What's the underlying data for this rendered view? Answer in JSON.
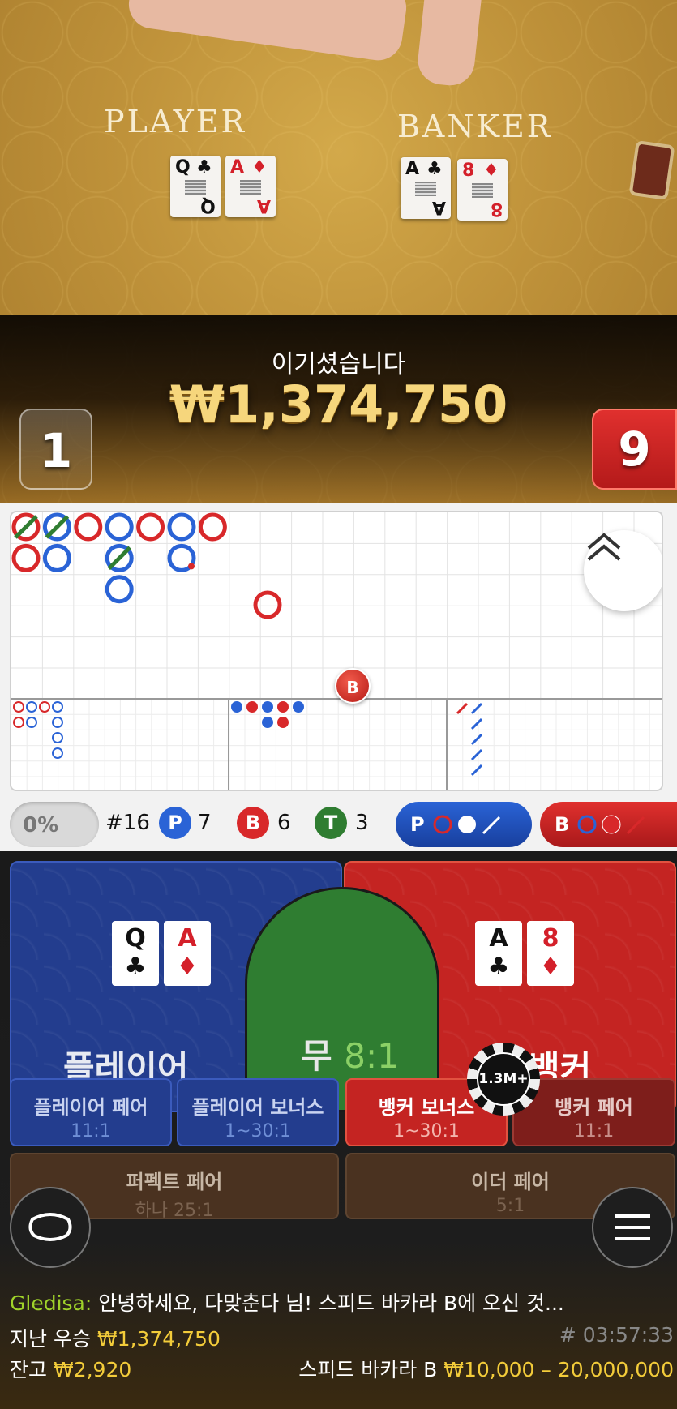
{
  "table_felt": {
    "player_word": "PLAYER",
    "banker_word": "BANKER"
  },
  "dealt_cards": {
    "player": [
      {
        "rank": "Q",
        "suit": "♣",
        "color": "black"
      },
      {
        "rank": "A",
        "suit": "♦",
        "color": "red"
      }
    ],
    "banker": [
      {
        "rank": "A",
        "suit": "♣",
        "color": "black"
      },
      {
        "rank": "8",
        "suit": "♦",
        "color": "red"
      }
    ]
  },
  "result": {
    "title": "이기셨습니다",
    "amount": "₩1,374,750",
    "player_score": "1",
    "banker_score": "9"
  },
  "roadmap": {
    "marker_label": "B",
    "big_road": [
      {
        "col": 0,
        "row": 0,
        "side": "banker",
        "tie": true
      },
      {
        "col": 0,
        "row": 1,
        "side": "banker"
      },
      {
        "col": 1,
        "row": 0,
        "side": "player",
        "tie": true
      },
      {
        "col": 1,
        "row": 1,
        "side": "player"
      },
      {
        "col": 2,
        "row": 0,
        "side": "banker"
      },
      {
        "col": 3,
        "row": 0,
        "side": "player"
      },
      {
        "col": 3,
        "row": 1,
        "side": "player",
        "tie": true
      },
      {
        "col": 3,
        "row": 2,
        "side": "player"
      },
      {
        "col": 4,
        "row": 0,
        "side": "banker"
      },
      {
        "col": 5,
        "row": 0,
        "side": "player"
      },
      {
        "col": 5,
        "row": 1,
        "side": "player",
        "pending": true
      },
      {
        "col": 6,
        "row": 0,
        "side": "banker"
      }
    ]
  },
  "stats": {
    "percent": "0%",
    "round": "#16",
    "player": {
      "letter": "P",
      "count": "7"
    },
    "banker": {
      "letter": "B",
      "count": "6"
    },
    "tie": {
      "letter": "T",
      "count": "3"
    },
    "ask_player": "P",
    "ask_banker": "B"
  },
  "bets": {
    "player": {
      "label": "플레이어"
    },
    "tie": {
      "label": "무",
      "odds": "8:1"
    },
    "banker": {
      "label": "뱅커"
    },
    "player_pair": {
      "label": "플레이어 페어",
      "odds": "11:1"
    },
    "player_bonus": {
      "label": "플레이어 보너스",
      "odds": "1~30:1"
    },
    "banker_bonus": {
      "label": "뱅커 보너스",
      "odds": "1~30:1"
    },
    "banker_pair": {
      "label": "뱅커 페어",
      "odds": "11:1"
    },
    "perfect_pair": {
      "label": "퍼펙트 페어",
      "odds": "하나 25:1"
    },
    "either_pair": {
      "label": "이더 페어",
      "odds": "5:1"
    },
    "chip": "1.3M+"
  },
  "chat": {
    "name": "Gledisa:",
    "message": "안녕하세요, 다맞춘다 님! 스피드 바카라 B에 오신 것..."
  },
  "footer": {
    "last_win_label": "지난 우승",
    "last_win_value": "₩1,374,750",
    "game_id": "# 03:57:33",
    "balance_label": "잔고",
    "balance_value": "₩2,920",
    "table_name": "스피드 바카라 B",
    "limits": "₩10,000 – 20,000,000"
  },
  "colors": {
    "player": "#2a63d6",
    "banker": "#d8282a",
    "tie": "#2f7d31",
    "gold": "#f3cc3a"
  }
}
